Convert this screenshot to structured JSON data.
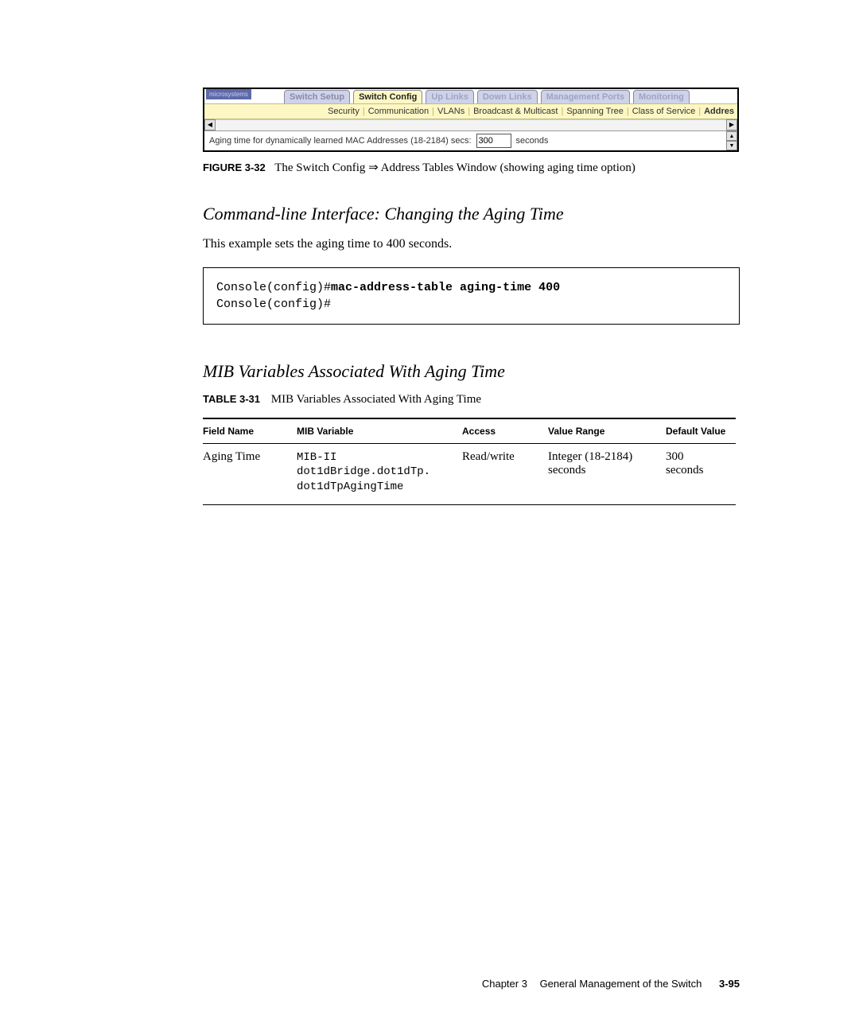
{
  "ui": {
    "logo": "microsystems",
    "main_tabs": {
      "t0": "Switch Setup",
      "t1": "Switch Config",
      "t2": "Up Links",
      "t3": "Down Links",
      "t4": "Management Ports",
      "t5": "Monitoring"
    },
    "sub_tabs": {
      "s0": "Security",
      "s1": "Communication",
      "s2": "VLANs",
      "s3": "Broadcast & Multicast",
      "s4": "Spanning Tree",
      "s5": "Class of Service",
      "s6": "Addres"
    },
    "content": {
      "label": "Aging time for dynamically learned MAC Addresses (18-2184) secs:",
      "value": "300",
      "unit": "seconds"
    }
  },
  "figure": {
    "lead": "FIGURE 3-32",
    "text": "The Switch Config ⇒ Address Tables Window (showing aging time option)"
  },
  "section1": {
    "title": "Command-line Interface: Changing the Aging Time",
    "body": "This example sets the aging time to 400 seconds."
  },
  "code": {
    "prompt1": "Console(config)#",
    "cmd": "mac-address-table aging-time 400",
    "prompt2": "Console(config)#"
  },
  "section2": {
    "title": "MIB Variables Associated With Aging Time"
  },
  "table": {
    "lead": "TABLE 3-31",
    "caption": "MIB Variables Associated With Aging Time",
    "headers": {
      "h0": "Field Name",
      "h1": "MIB Variable",
      "h2": "Access",
      "h3": "Value Range",
      "h4": "Default Value"
    },
    "row": {
      "field": "Aging Time",
      "mib_l1": "MIB-II",
      "mib_l2": "dot1dBridge.dot1dTp.",
      "mib_l3": "dot1dTpAgingTime",
      "access": "Read/write",
      "range_l1": "Integer (18-2184)",
      "range_l2": "seconds",
      "default_l1": "300",
      "default_l2": "seconds"
    }
  },
  "footer": {
    "chapter": "Chapter 3",
    "title": "General Management of the Switch",
    "page": "3-95"
  }
}
